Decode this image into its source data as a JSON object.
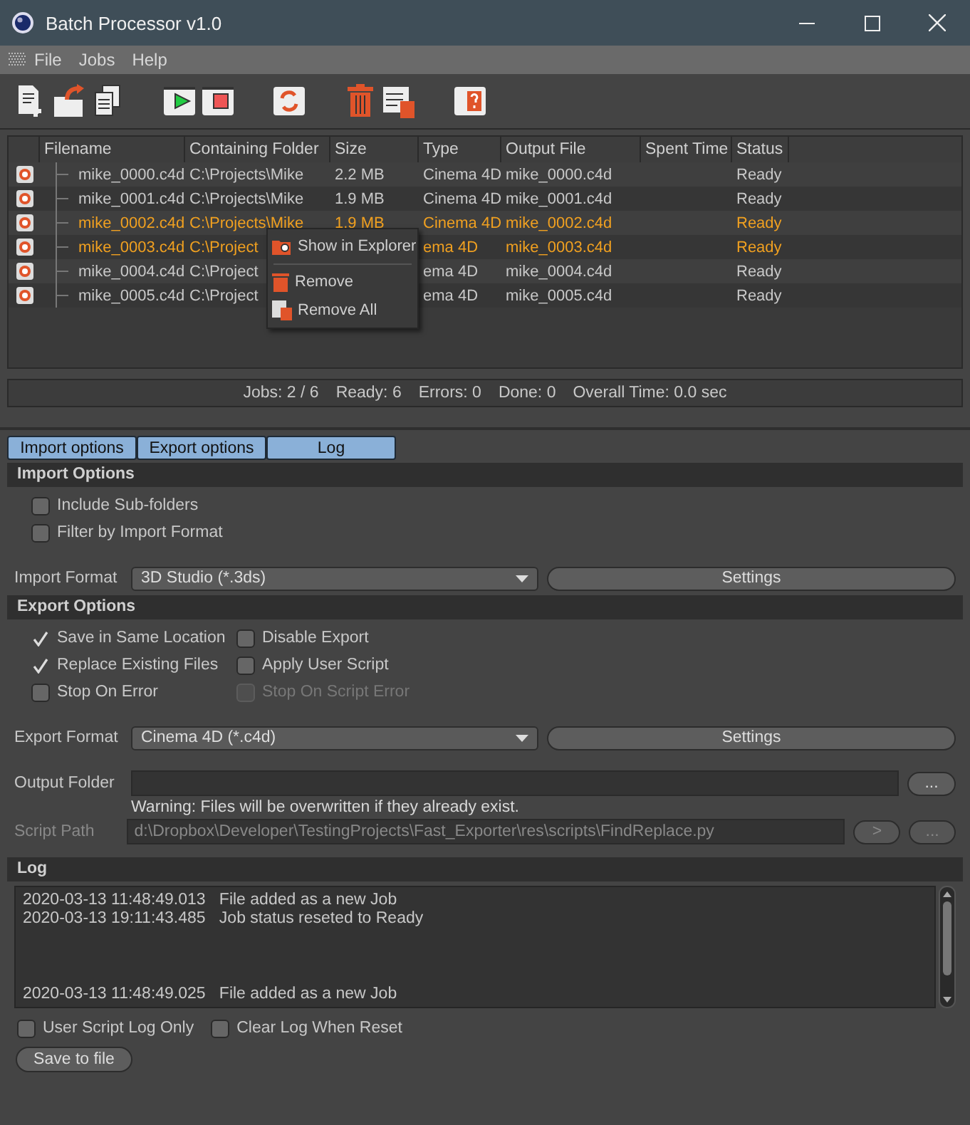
{
  "window": {
    "title": "Batch Processor v1.0"
  },
  "menu": [
    "File",
    "Jobs",
    "Help"
  ],
  "table": {
    "columns": [
      "Filename",
      "Containing Folder",
      "Size",
      "Type",
      "Output File",
      "Spent Time",
      "Status"
    ],
    "rows": [
      {
        "selected": false,
        "cells": [
          "mike_0000.c4d",
          "C:\\Projects\\Mike",
          "2.2 MB",
          "Cinema 4D",
          "mike_0000.c4d",
          "",
          "Ready"
        ]
      },
      {
        "selected": false,
        "cells": [
          "mike_0001.c4d",
          "C:\\Projects\\Mike",
          "1.9 MB",
          "Cinema 4D",
          "mike_0001.c4d",
          "",
          "Ready"
        ]
      },
      {
        "selected": true,
        "cells": [
          "mike_0002.c4d",
          "C:\\Projects\\Mike",
          "1.9 MB",
          "Cinema 4D",
          "mike_0002.c4d",
          "",
          "Ready"
        ]
      },
      {
        "selected": true,
        "cells": [
          "mike_0003.c4d",
          "C:\\Project",
          "",
          "ema 4D",
          "mike_0003.c4d",
          "",
          "Ready"
        ]
      },
      {
        "selected": false,
        "cells": [
          "mike_0004.c4d",
          "C:\\Project",
          "",
          "ema 4D",
          "mike_0004.c4d",
          "",
          "Ready"
        ]
      },
      {
        "selected": false,
        "cells": [
          "mike_0005.c4d",
          "C:\\Project",
          "",
          "ema 4D",
          "mike_0005.c4d",
          "",
          "Ready"
        ]
      }
    ]
  },
  "context_menu": {
    "items": [
      {
        "kind": "explorer",
        "label": "Show in Explorer"
      },
      {
        "kind": "remove",
        "label": "Remove"
      },
      {
        "kind": "remove-all",
        "label": "Remove All"
      }
    ]
  },
  "status_bar": [
    "Jobs: 2 / 6",
    "Ready: 6",
    "Errors: 0",
    "Done: 0",
    "Overall Time: 0.0 sec"
  ],
  "tabs": [
    {
      "label": "Import options",
      "selected": false
    },
    {
      "label": "Export options",
      "selected": false
    },
    {
      "label": "Log",
      "selected": false
    }
  ],
  "import_options": {
    "title": "Import Options",
    "checkboxes": [
      {
        "label": "Include Sub-folders",
        "checked": false,
        "disabled": false
      },
      {
        "label": "Filter by Import Format",
        "checked": false,
        "disabled": false
      }
    ],
    "format_label": "Import Format",
    "format_value": "3D Studio (*.3ds)",
    "settings_button": "Settings"
  },
  "export_options": {
    "title": "Export Options",
    "checkboxes": [
      {
        "label": "Save in Same Location",
        "checked": true,
        "disabled": false
      },
      {
        "label": "Disable Export",
        "checked": false,
        "disabled": false
      },
      {
        "label": "Replace Existing Files",
        "checked": true,
        "disabled": false
      },
      {
        "label": "Apply User Script",
        "checked": false,
        "disabled": false
      },
      {
        "label": "Stop On Error",
        "checked": false,
        "disabled": false
      },
      {
        "label": "Stop On Script Error",
        "checked": false,
        "disabled": true
      }
    ],
    "format_label": "Export Format",
    "format_value": "Cinema 4D (*.c4d)",
    "settings_button": "Settings",
    "output_folder_label": "Output Folder",
    "output_browse_button": "...",
    "warning": "Warning: Files will be overwritten if they already exist.",
    "script_path_label": "Script Path",
    "script_path_value": "d:\\Dropbox\\Developer\\TestingProjects\\Fast_Exporter\\res\\scripts\\FindReplace.py",
    "script_path_disabled": true,
    "run_button": ">",
    "script_browse_button": "..."
  },
  "log": {
    "title": "Log",
    "groups": [
      [
        {
          "time": "2020-03-13 11:48:49.013",
          "message": "File added as a new Job"
        },
        {
          "time": "2020-03-13 19:11:43.485",
          "message": "Job status reseted to Ready"
        }
      ],
      [
        {
          "time": "2020-03-13 11:48:49.025",
          "message": "File added as a new Job"
        }
      ]
    ],
    "checkboxes": [
      {
        "label": "User Script Log Only",
        "checked": false,
        "disabled": false
      },
      {
        "label": "Clear Log When Reset",
        "checked": false,
        "disabled": false
      }
    ],
    "save_button": "Save to file"
  }
}
